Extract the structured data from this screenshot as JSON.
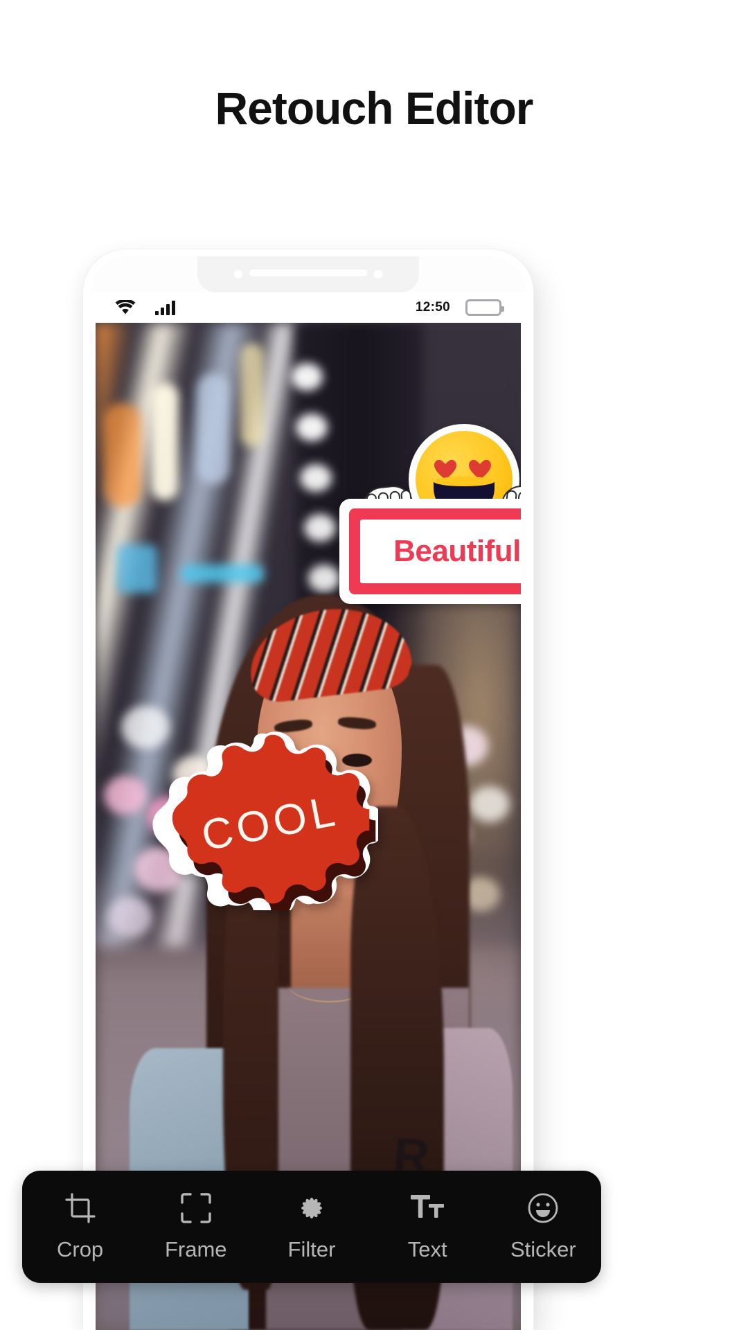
{
  "page": {
    "title": "Retouch Editor",
    "background_color": "#ffffff"
  },
  "phone": {
    "status_bar": {
      "wifi_icon": "wifi-icon",
      "signal_icon": "signal-bars-icon",
      "time": "12:50",
      "battery_icon": "battery-full-icon"
    }
  },
  "canvas": {
    "stickers": [
      {
        "id": "beautiful",
        "name": "beautiful-sign-sticker",
        "text": "Beautiful",
        "emoji": "heart-eyes-smiley-icon",
        "border_color": "#ef3a54",
        "text_color": "#ef3a54",
        "face_color": "#ffc61e"
      },
      {
        "id": "cool",
        "name": "cool-burst-sticker",
        "text": "COOL",
        "shape": "starburst",
        "fill_color": "#d3321b",
        "shadow_color": "#3d0f08",
        "text_color": "#fdf6ee"
      }
    ]
  },
  "toolbar": {
    "accent_color": "#b6b6b6",
    "background_color": "#0b0b0b",
    "items": [
      {
        "label": "Crop",
        "icon": "crop-icon"
      },
      {
        "label": "Frame",
        "icon": "frame-corners-icon"
      },
      {
        "label": "Filter",
        "icon": "flower-filter-icon"
      },
      {
        "label": "Text",
        "icon": "text-tt-icon"
      },
      {
        "label": "Sticker",
        "icon": "smiley-sticker-icon"
      }
    ]
  }
}
